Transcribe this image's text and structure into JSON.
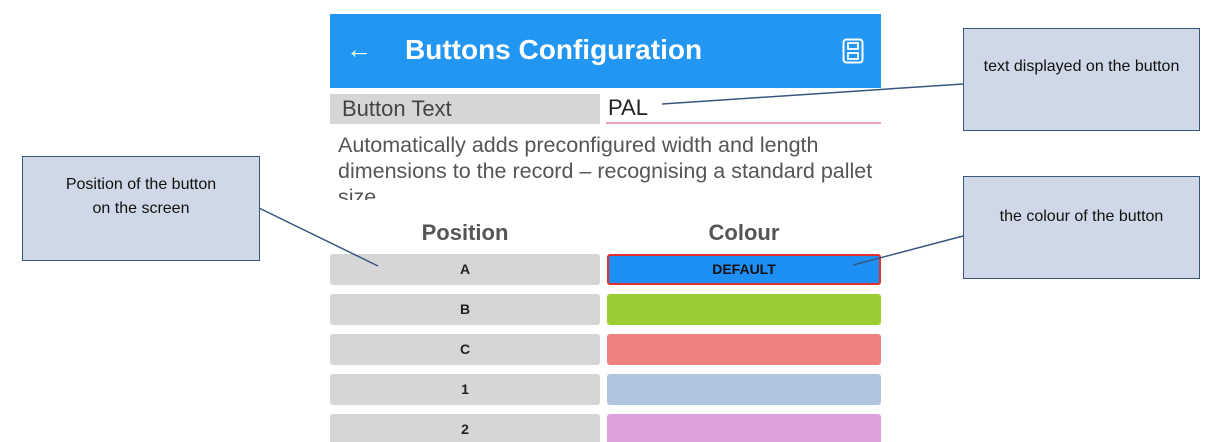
{
  "appbar": {
    "title": "Buttons Configuration",
    "back_icon": "arrow-left-icon",
    "save_icon": "save-icon",
    "color": "#2196f3"
  },
  "button_text": {
    "label": "Button Text",
    "value": "PAL"
  },
  "description": "Automatically adds preconfigured width and length dimensions to the record – recognising a standard pallet size",
  "table": {
    "position_header": "Position",
    "colour_header": "Colour",
    "rows": [
      {
        "position": "A",
        "colour_label": "DEFAULT",
        "colour": "#1e8ff5",
        "selected": true
      },
      {
        "position": "B",
        "colour_label": "",
        "colour": "#9acd32",
        "selected": false
      },
      {
        "position": "C",
        "colour_label": "",
        "colour": "#f08080",
        "selected": false
      },
      {
        "position": "1",
        "colour_label": "",
        "colour": "#b0c4de",
        "selected": false
      },
      {
        "position": "2",
        "colour_label": "",
        "colour": "#dda0dd",
        "selected": false
      }
    ]
  },
  "annotations": {
    "text": "text displayed on the button",
    "position": "Position of the button on the screen",
    "colour": "the colour of the button"
  }
}
